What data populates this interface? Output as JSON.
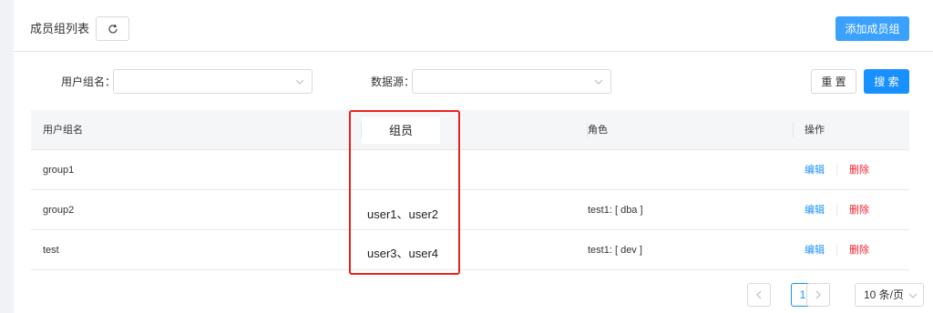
{
  "header": {
    "title": "成员组列表",
    "refresh_icon": "refresh-icon",
    "add_label": "添加成员组"
  },
  "filters": {
    "group_name_label": "用户组名：",
    "group_name_value": "",
    "datasource_label": "数据源：",
    "datasource_value": "",
    "reset_label": "重 置",
    "search_label": "搜 索"
  },
  "table": {
    "columns": [
      "用户组名",
      "组员",
      "角色",
      "操作"
    ],
    "rows": [
      {
        "name": "group1",
        "members": "",
        "roles": "",
        "edit": "编辑",
        "delete": "删除"
      },
      {
        "name": "group2",
        "members": "user1、user2",
        "roles": "test1: [ dba ]",
        "edit": "编辑",
        "delete": "删除"
      },
      {
        "name": "test",
        "members": "user3、user4",
        "roles": "test1: [ dev ]",
        "edit": "编辑",
        "delete": "删除"
      }
    ]
  },
  "pagination": {
    "current_page": "1",
    "page_size": "10 条/页"
  },
  "colors": {
    "primary": "#1890ff",
    "add_button": "#3aa1ff",
    "danger": "#f5222d",
    "highlight": "#e8221c"
  }
}
